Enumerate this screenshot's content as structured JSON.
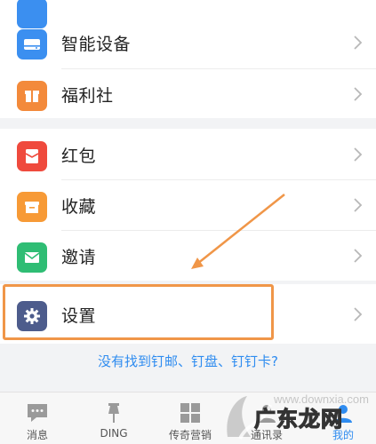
{
  "sections": [
    {
      "items": [
        {
          "label": "智能设备",
          "icon": "smart-device-icon",
          "color": "#3b8ff0"
        },
        {
          "label": "福利社",
          "icon": "gift-icon",
          "color": "#f38a3b"
        }
      ]
    },
    {
      "items": [
        {
          "label": "红包",
          "icon": "red-envelope-icon",
          "color": "#ef4a3d"
        },
        {
          "label": "收藏",
          "icon": "favorites-box-icon",
          "color": "#f79a36"
        },
        {
          "label": "邀请",
          "icon": "mail-icon",
          "color": "#2fbd74"
        }
      ]
    },
    {
      "items": [
        {
          "label": "设置",
          "icon": "gear-icon",
          "color": "#4d5c8c"
        }
      ]
    }
  ],
  "help_link": "没有找到钉邮、钉盘、钉钉卡?",
  "tabbar": {
    "items": [
      {
        "label": "消息",
        "icon": "chat-bubble-icon"
      },
      {
        "label": "DING",
        "icon": "pin-icon"
      },
      {
        "label": "传奇营销",
        "icon": "grid-apps-icon"
      },
      {
        "label": "通讯录",
        "icon": "contacts-icon"
      },
      {
        "label": "我的",
        "icon": "profile-icon",
        "active": true
      }
    ]
  },
  "watermark": {
    "text": "广东龙网"
  },
  "annotation_color": "#f09648",
  "accent_color": "#2f8cf0"
}
